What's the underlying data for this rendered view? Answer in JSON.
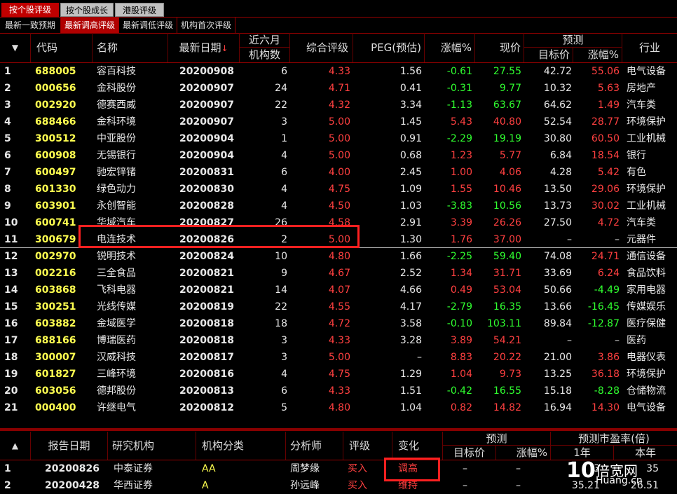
{
  "tabs": [
    "按个股评级",
    "按个股成长",
    "港股评级"
  ],
  "subtabs": [
    "最新一致预期",
    "最新调高评级",
    "最新调低评级",
    "机构首次评级"
  ],
  "header": {
    "sort_icon": "▼",
    "code": "代码",
    "name": "名称",
    "date": "最新日期",
    "date_sort": "↓",
    "inst_top": "近六月",
    "inst_bottom": "机构数",
    "rating": "综合评级",
    "peg": "PEG(预估)",
    "change": "涨幅%",
    "price": "现价",
    "forecast": "预测",
    "target": "目标价",
    "fchange": "涨幅%",
    "industry": "行业"
  },
  "rows": [
    {
      "idx": "1",
      "code": "688005",
      "name": "容百科技",
      "date": "20200908",
      "inst": "6",
      "rating": "4.33",
      "peg": "1.56",
      "chg": "-0.61",
      "price": "27.55",
      "target": "42.72",
      "fchg": "55.06",
      "ind": "电气设备",
      "chg_dir": "down",
      "price_dir": "down",
      "fchg_dir": "up"
    },
    {
      "idx": "2",
      "code": "000656",
      "name": "金科股份",
      "date": "20200907",
      "inst": "24",
      "rating": "4.71",
      "peg": "0.41",
      "chg": "-0.31",
      "price": "9.77",
      "target": "10.32",
      "fchg": "5.63",
      "ind": "房地产",
      "chg_dir": "down",
      "price_dir": "down",
      "fchg_dir": "up"
    },
    {
      "idx": "3",
      "code": "002920",
      "name": "德赛西威",
      "date": "20200907",
      "inst": "22",
      "rating": "4.32",
      "peg": "3.34",
      "chg": "-1.13",
      "price": "63.67",
      "target": "64.62",
      "fchg": "1.49",
      "ind": "汽车类",
      "chg_dir": "down",
      "price_dir": "down",
      "fchg_dir": "up"
    },
    {
      "idx": "4",
      "code": "688466",
      "name": "金科环境",
      "date": "20200907",
      "inst": "3",
      "rating": "5.00",
      "peg": "1.45",
      "chg": "5.43",
      "price": "40.80",
      "target": "52.54",
      "fchg": "28.77",
      "ind": "环境保护",
      "chg_dir": "up",
      "price_dir": "up",
      "fchg_dir": "up"
    },
    {
      "idx": "5",
      "code": "300512",
      "name": "中亚股份",
      "date": "20200904",
      "inst": "1",
      "rating": "5.00",
      "peg": "0.91",
      "chg": "-2.29",
      "price": "19.19",
      "target": "30.80",
      "fchg": "60.50",
      "ind": "工业机械",
      "chg_dir": "down",
      "price_dir": "down",
      "fchg_dir": "up"
    },
    {
      "idx": "6",
      "code": "600908",
      "name": "无锡银行",
      "date": "20200904",
      "inst": "4",
      "rating": "5.00",
      "peg": "0.68",
      "chg": "1.23",
      "price": "5.77",
      "target": "6.84",
      "fchg": "18.54",
      "ind": "银行",
      "chg_dir": "up",
      "price_dir": "up",
      "fchg_dir": "up"
    },
    {
      "idx": "7",
      "code": "600497",
      "name": "驰宏锌锗",
      "date": "20200831",
      "inst": "6",
      "rating": "4.00",
      "peg": "2.45",
      "chg": "1.00",
      "price": "4.06",
      "target": "4.28",
      "fchg": "5.42",
      "ind": "有色",
      "chg_dir": "up",
      "price_dir": "up",
      "fchg_dir": "up"
    },
    {
      "idx": "8",
      "code": "601330",
      "name": "绿色动力",
      "date": "20200830",
      "inst": "4",
      "rating": "4.75",
      "peg": "1.09",
      "chg": "1.55",
      "price": "10.46",
      "target": "13.50",
      "fchg": "29.06",
      "ind": "环境保护",
      "chg_dir": "up",
      "price_dir": "up",
      "fchg_dir": "up"
    },
    {
      "idx": "9",
      "code": "603901",
      "name": "永创智能",
      "date": "20200828",
      "inst": "4",
      "rating": "4.50",
      "peg": "1.03",
      "chg": "-3.83",
      "price": "10.56",
      "target": "13.73",
      "fchg": "30.02",
      "ind": "工业机械",
      "chg_dir": "down",
      "price_dir": "down",
      "fchg_dir": "up"
    },
    {
      "idx": "10",
      "code": "600741",
      "name": "华域汽车",
      "date": "20200827",
      "inst": "26",
      "rating": "4.58",
      "peg": "2.91",
      "chg": "3.39",
      "price": "26.26",
      "target": "27.50",
      "fchg": "4.72",
      "ind": "汽车类",
      "chg_dir": "up",
      "price_dir": "up",
      "fchg_dir": "up"
    },
    {
      "idx": "11",
      "code": "300679",
      "name": "电连技术",
      "date": "20200826",
      "inst": "2",
      "rating": "5.00",
      "peg": "1.30",
      "chg": "1.76",
      "price": "37.00",
      "target": "–",
      "fchg": "–",
      "ind": "元器件",
      "chg_dir": "up",
      "price_dir": "up",
      "fchg_dir": "none"
    },
    {
      "idx": "12",
      "code": "002970",
      "name": "锐明技术",
      "date": "20200824",
      "inst": "10",
      "rating": "4.80",
      "peg": "1.66",
      "chg": "-2.25",
      "price": "59.40",
      "target": "74.08",
      "fchg": "24.71",
      "ind": "通信设备",
      "chg_dir": "down",
      "price_dir": "down",
      "fchg_dir": "up"
    },
    {
      "idx": "13",
      "code": "002216",
      "name": "三全食品",
      "date": "20200821",
      "inst": "9",
      "rating": "4.67",
      "peg": "2.52",
      "chg": "1.34",
      "price": "31.71",
      "target": "33.69",
      "fchg": "6.24",
      "ind": "食品饮料",
      "chg_dir": "up",
      "price_dir": "up",
      "fchg_dir": "up"
    },
    {
      "idx": "14",
      "code": "603868",
      "name": "飞科电器",
      "date": "20200821",
      "inst": "14",
      "rating": "4.07",
      "peg": "4.66",
      "chg": "0.49",
      "price": "53.04",
      "target": "50.66",
      "fchg": "-4.49",
      "ind": "家用电器",
      "chg_dir": "up",
      "price_dir": "up",
      "fchg_dir": "down"
    },
    {
      "idx": "15",
      "code": "300251",
      "name": "光线传媒",
      "date": "20200819",
      "inst": "22",
      "rating": "4.55",
      "peg": "4.17",
      "chg": "-2.79",
      "price": "16.35",
      "target": "13.66",
      "fchg": "-16.45",
      "ind": "传媒娱乐",
      "chg_dir": "down",
      "price_dir": "down",
      "fchg_dir": "down"
    },
    {
      "idx": "16",
      "code": "603882",
      "name": "金域医学",
      "date": "20200818",
      "inst": "18",
      "rating": "4.72",
      "peg": "3.58",
      "chg": "-0.10",
      "price": "103.11",
      "target": "89.84",
      "fchg": "-12.87",
      "ind": "医疗保健",
      "chg_dir": "down",
      "price_dir": "down",
      "fchg_dir": "down"
    },
    {
      "idx": "17",
      "code": "688166",
      "name": "博瑞医药",
      "date": "20200818",
      "inst": "3",
      "rating": "4.33",
      "peg": "3.28",
      "chg": "3.89",
      "price": "54.21",
      "target": "–",
      "fchg": "–",
      "ind": "医药",
      "chg_dir": "up",
      "price_dir": "up",
      "fchg_dir": "none"
    },
    {
      "idx": "18",
      "code": "300007",
      "name": "汉威科技",
      "date": "20200817",
      "inst": "3",
      "rating": "5.00",
      "peg": "–",
      "chg": "8.83",
      "price": "20.22",
      "target": "21.00",
      "fchg": "3.86",
      "ind": "电器仪表",
      "chg_dir": "up",
      "price_dir": "up",
      "fchg_dir": "up"
    },
    {
      "idx": "19",
      "code": "601827",
      "name": "三峰环境",
      "date": "20200816",
      "inst": "4",
      "rating": "4.75",
      "peg": "1.29",
      "chg": "1.04",
      "price": "9.73",
      "target": "13.25",
      "fchg": "36.18",
      "ind": "环境保护",
      "chg_dir": "up",
      "price_dir": "up",
      "fchg_dir": "up"
    },
    {
      "idx": "20",
      "code": "603056",
      "name": "德邦股份",
      "date": "20200813",
      "inst": "6",
      "rating": "4.33",
      "peg": "1.51",
      "chg": "-0.42",
      "price": "16.55",
      "target": "15.18",
      "fchg": "-8.28",
      "ind": "仓储物流",
      "chg_dir": "down",
      "price_dir": "down",
      "fchg_dir": "down"
    },
    {
      "idx": "21",
      "code": "000400",
      "name": "许继电气",
      "date": "20200812",
      "inst": "5",
      "rating": "4.80",
      "peg": "1.04",
      "chg": "0.82",
      "price": "14.82",
      "target": "16.94",
      "fchg": "14.30",
      "ind": "电气设备",
      "chg_dir": "up",
      "price_dir": "up",
      "fchg_dir": "up"
    }
  ],
  "bottom_header": {
    "sort_icon": "▲",
    "date": "报告日期",
    "org": "研究机构",
    "org_type": "机构分类",
    "analyst": "分析师",
    "rating": "评级",
    "change": "变化",
    "forecast": "预测",
    "target": "目标价",
    "fchange": "涨幅%",
    "pe": "预测市盈率(倍)",
    "pe_y1": "1年",
    "pe_y2": "本年"
  },
  "bottom_rows": [
    {
      "idx": "1",
      "date": "20200826",
      "org": "中泰证券",
      "type": "AA",
      "analyst": "周梦缘",
      "rating": "买入",
      "change": "调高",
      "target": "–",
      "fchg": "–",
      "pe1": "3",
      "pe2": "35"
    },
    {
      "idx": "2",
      "date": "20200428",
      "org": "华西证券",
      "type": "A",
      "analyst": "孙远峰",
      "rating": "买入",
      "change": "维持",
      "target": "–",
      "fchg": "–",
      "pe1": "35.21",
      "pe2": "26.51"
    }
  ],
  "watermark": {
    "big": "10",
    "cn": "倍宽网",
    "en": "Huang.cn"
  },
  "colors": {
    "up": "#ff4040",
    "down": "#30ff30",
    "code": "#ffff50",
    "highlight": "#ff2020"
  }
}
